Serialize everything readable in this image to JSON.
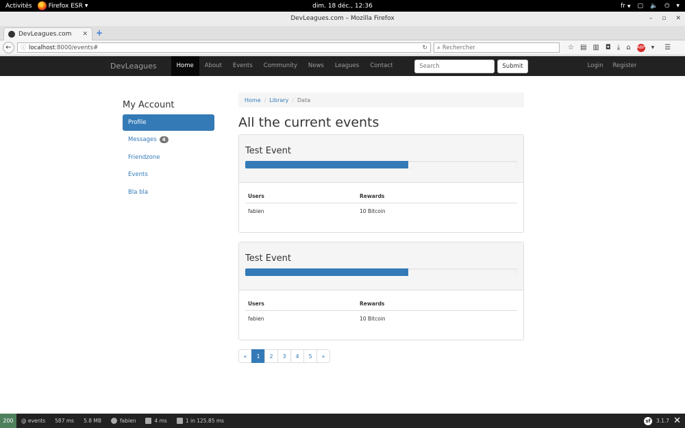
{
  "gnome": {
    "activities": "Activités",
    "app": "Firefox ESR",
    "clock": "dim. 18 déc., 12:36",
    "lang": "fr"
  },
  "window": {
    "title": "DevLeagues.com – Mozilla Firefox",
    "tab_title": "DevLeagues.com"
  },
  "browser": {
    "url_host": "localhost",
    "url_path": ":8000/events#",
    "search_placeholder": "Rechercher",
    "addon_badge": "ABP"
  },
  "site": {
    "brand": "DevLeagues",
    "nav": [
      "Home",
      "About",
      "Events",
      "Community",
      "News",
      "Leagues",
      "Contact"
    ],
    "active_nav": 0,
    "search_placeholder": "Search",
    "submit": "Submit",
    "login": "Login",
    "register": "Register"
  },
  "sidebar": {
    "title": "My Account",
    "items": [
      {
        "label": "Profile",
        "active": true
      },
      {
        "label": "Messages",
        "badge": "4"
      },
      {
        "label": "Friendzone"
      },
      {
        "label": "Events"
      },
      {
        "label": "Bla bla"
      }
    ]
  },
  "main": {
    "breadcrumb": [
      "Home",
      "Library",
      "Data"
    ],
    "title": "All the current events",
    "events": [
      {
        "name": "Test Event",
        "progress": 60,
        "columns": [
          "Users",
          "Rewards"
        ],
        "rows": [
          [
            "fabien",
            "10 Bitcoin"
          ]
        ]
      },
      {
        "name": "Test Event",
        "progress": 60,
        "columns": [
          "Users",
          "Rewards"
        ],
        "rows": [
          [
            "fabien",
            "10 Bitcoin"
          ]
        ]
      }
    ],
    "pagination": [
      "«",
      "1",
      "2",
      "3",
      "4",
      "5",
      "»"
    ],
    "active_page": 1
  },
  "toolbar": {
    "status": "200",
    "route": "@ events",
    "time": "587 ms",
    "memory": "5.8 MB",
    "user": "fabien",
    "form_time": "4 ms",
    "db": "1 in 125.85 ms",
    "version": "3.1.7"
  }
}
